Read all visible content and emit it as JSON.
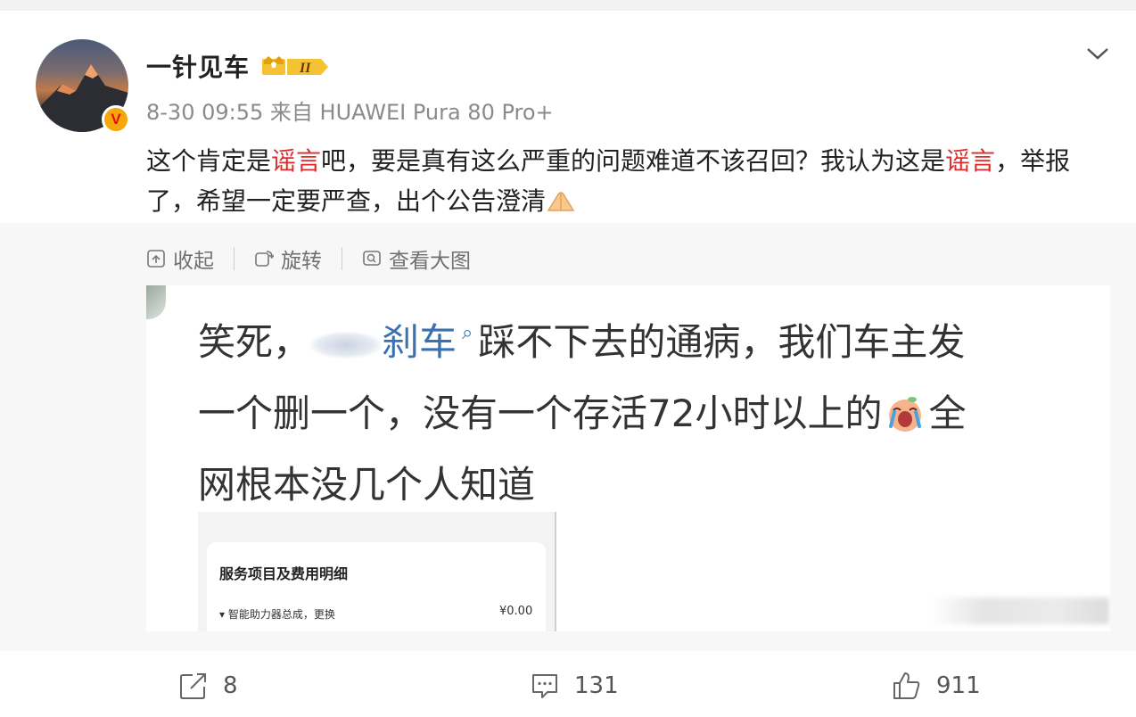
{
  "post": {
    "author": "一针见车",
    "meta": "8-30 09:55 来自 HUAWEI Pura 80 Pro+",
    "text": {
      "p1": "这个肯定是",
      "hl1": "谣言",
      "p2": "吧，要是真有这么严重的问题难道不该召回？我认为这是",
      "hl2": "谣言",
      "p3": "，举报了，希望一定要严查，出个公告澄清"
    },
    "highlight_color": "#e02a2a"
  },
  "image_toolbar": {
    "collapse": "收起",
    "rotate": "旋转",
    "view_large": "查看大图"
  },
  "image": {
    "line1_a": "笑死，",
    "line1_link": "刹车",
    "line1_b": "踩不下去的通病，我们车主发",
    "line2": "一个删一个，没有一个存活72小时以上的",
    "line2_b": "全",
    "line3": "网根本没几个人知道",
    "card_title": "服务项目及费用明细",
    "card_item": "▾ 智能助力器总成，更换",
    "card_price": "¥0.00"
  },
  "actions": {
    "share_count": "8",
    "comment_count": "131",
    "like_count": "911"
  }
}
